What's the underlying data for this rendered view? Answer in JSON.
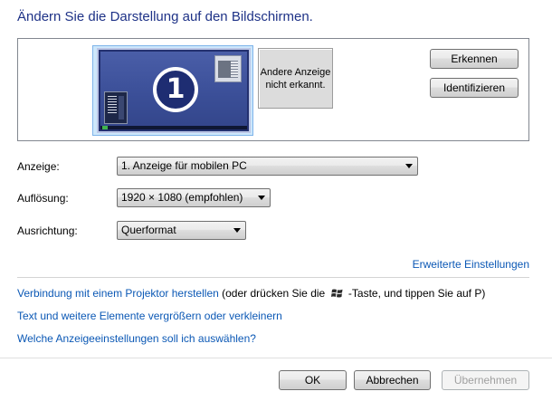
{
  "header": {
    "title": "Ändern Sie die Darstellung auf den Bildschirmen."
  },
  "preview": {
    "monitor1_number": "1",
    "monitor2_text_line1": "Andere Anzeige",
    "monitor2_text_line2": "nicht erkannt."
  },
  "buttons": {
    "detect": "Erkennen",
    "identify": "Identifizieren"
  },
  "fields": {
    "display_label": "Anzeige:",
    "display_value": "1. Anzeige für mobilen PC",
    "resolution_label": "Auflösung:",
    "resolution_value": "1920 × 1080 (empfohlen)",
    "orientation_label": "Ausrichtung:",
    "orientation_value": "Querformat"
  },
  "links": {
    "advanced": "Erweiterte Einstellungen",
    "projector": "Verbindung mit einem Projektor herstellen",
    "projector_hint_before": "(oder drücken Sie die",
    "projector_hint_after": "-Taste, und tippen Sie auf P)",
    "text_size": "Text und weitere Elemente vergrößern oder verkleinern",
    "which_settings": "Welche Anzeigeeinstellungen soll ich auswählen?"
  },
  "footer": {
    "ok": "OK",
    "cancel": "Abbrechen",
    "apply": "Übernehmen"
  },
  "colors": {
    "title": "#1e3287",
    "link": "#0b58b5",
    "monitor_bg": "#3b4f98",
    "selection": "#cde7fb"
  },
  "icons": {
    "windows_key": "windows-logo-icon",
    "dropdown": "chevron-down-icon"
  }
}
